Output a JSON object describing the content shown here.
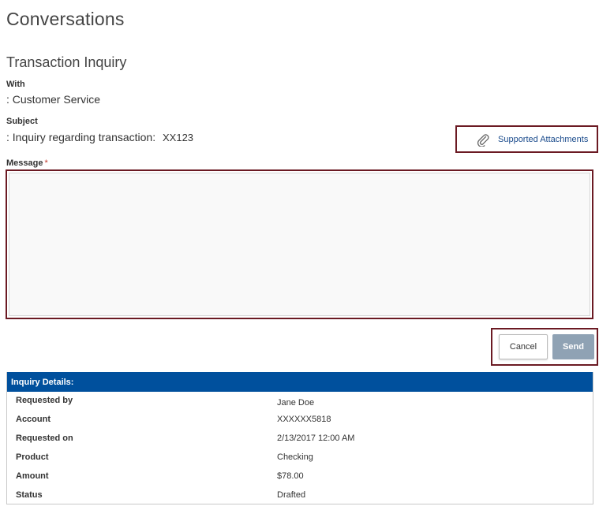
{
  "page": {
    "title": "Conversations",
    "section_title": "Transaction Inquiry"
  },
  "with": {
    "label": "With",
    "value": ": Customer Service"
  },
  "subject": {
    "label": "Subject",
    "value_prefix": ": Inquiry regarding transaction:",
    "transaction_id": "XX123"
  },
  "attachments": {
    "link_label": "Supported Attachments",
    "icon": "paperclip-icon"
  },
  "message": {
    "label": "Message",
    "required_marker": "*",
    "value": "",
    "placeholder": ""
  },
  "buttons": {
    "cancel": "Cancel",
    "send": "Send"
  },
  "details": {
    "header": "Inquiry Details:",
    "rows": [
      {
        "key": "Requested by",
        "value": "Jane Doe"
      },
      {
        "key": "Account",
        "value": "XXXXXX5818"
      },
      {
        "key": "Requested on",
        "value": "2/13/2017 12:00 AM"
      },
      {
        "key": "Product",
        "value": "Checking"
      },
      {
        "key": "Amount",
        "value": "$78.00"
      },
      {
        "key": "Status",
        "value": "Drafted"
      }
    ]
  },
  "colors": {
    "highlight_border": "#6b1a23",
    "header_blue": "#00509d",
    "link_blue": "#1a4b8c",
    "send_disabled": "#8fa2b4"
  }
}
